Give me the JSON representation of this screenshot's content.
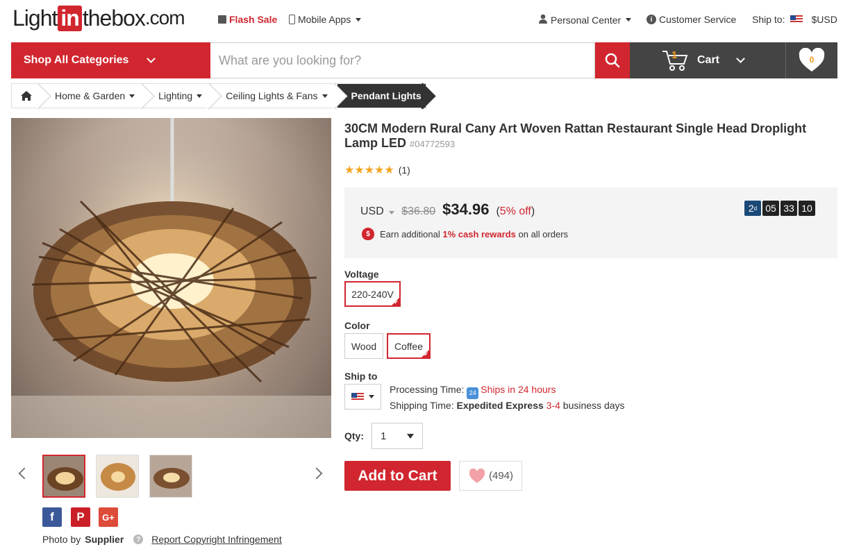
{
  "header": {
    "logo": {
      "light": "Light",
      "in": "in",
      "thebox": "thebox",
      "com": ".com"
    },
    "flash_sale": "Flash Sale",
    "mobile_apps": "Mobile Apps",
    "personal_center": "Personal Center",
    "customer_service": "Customer Service",
    "ship_to": "Ship to:",
    "currency": "$USD"
  },
  "nav": {
    "shop_all": "Shop All Categories",
    "search_placeholder": "What are you looking for?",
    "cart_label": "Cart",
    "cart_count": "1",
    "wishlist_count": "0"
  },
  "breadcrumb": [
    "Home & Garden",
    "Lighting",
    "Ceiling Lights & Fans",
    "Pendant Lights"
  ],
  "product": {
    "title": "30CM Modern Rural Cany Art Woven Rattan Restaurant Single Head Droplight Lamp LED",
    "sku": "#04772593",
    "rating": 5,
    "review_count": "(1)",
    "price": {
      "currency": "USD",
      "old": "$36.80",
      "new": "$34.96",
      "off_open": "(",
      "off_pct": "5% off",
      "off_close": ")"
    },
    "timer": {
      "days": "2",
      "days_suffix": "d",
      "hours": "05",
      "minutes": "33",
      "seconds": "10"
    },
    "reward": {
      "pre": "Earn additional",
      "highlight": "1% cash rewards",
      "post": "on all orders"
    },
    "voltage_label": "Voltage",
    "voltage_options": [
      "220-240V"
    ],
    "color_label": "Color",
    "color_options": [
      "Wood",
      "Coffee"
    ],
    "ship_label": "Ship to",
    "processing_label": "Processing Time:",
    "processing_value": "Ships in 24 hours",
    "shipping_label": "Shipping Time:",
    "shipping_method": "Expedited Express",
    "shipping_days": "3-4",
    "shipping_suffix": "business days",
    "qty_label": "Qty:",
    "qty_value": "1",
    "add_to_cart": "Add to Cart",
    "favorites_count": "(494)",
    "photo_by_label": "Photo by",
    "photo_by_value": "Supplier",
    "report_link": "Report Copyright Infringement"
  },
  "colors": {
    "brand_red": "#d1262f",
    "dark": "#444444"
  }
}
